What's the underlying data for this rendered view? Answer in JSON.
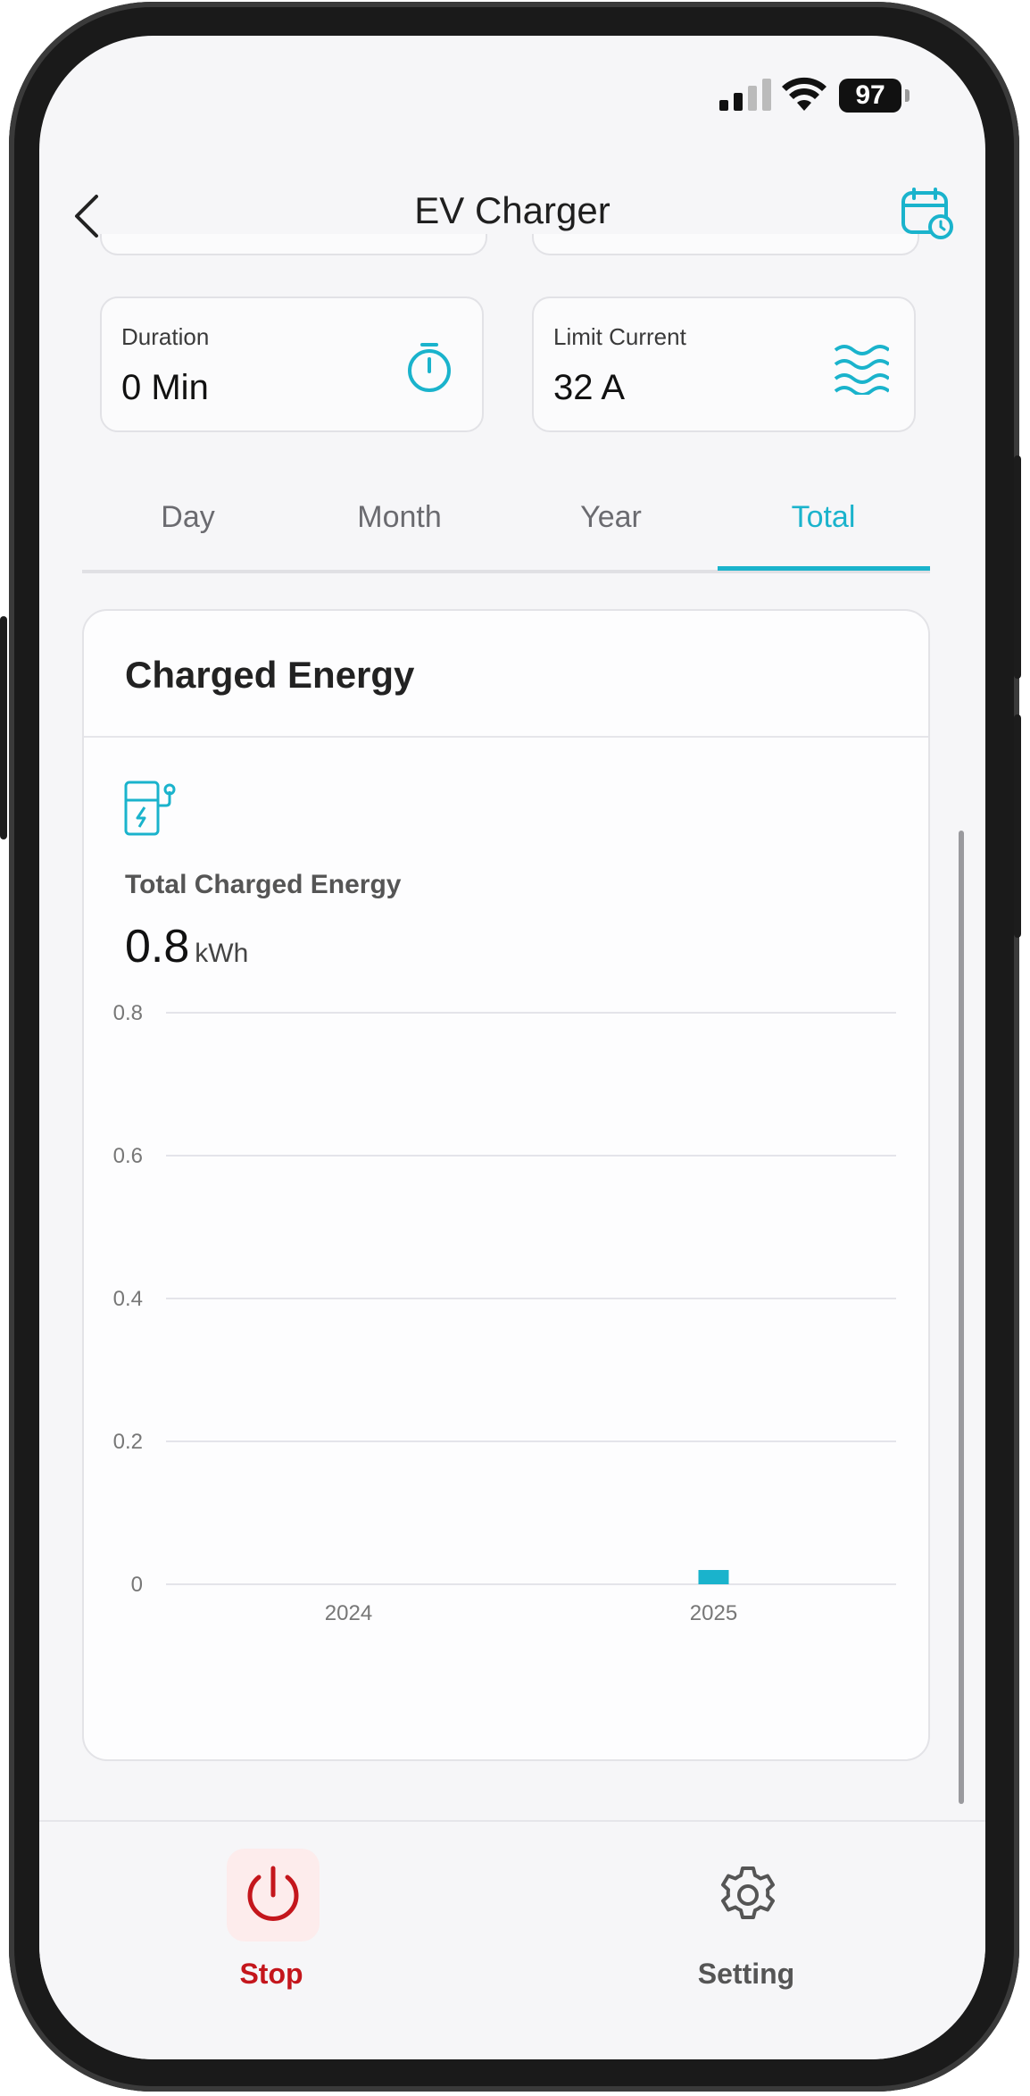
{
  "status_bar": {
    "battery": "97"
  },
  "header": {
    "title": "EV Charger"
  },
  "stats": [
    {
      "label": "Duration",
      "value": "0 Min",
      "icon": "stopwatch-icon"
    },
    {
      "label": "Limit Current",
      "value": "32 A",
      "icon": "current-waves-icon"
    }
  ],
  "tabs": [
    {
      "label": "Day"
    },
    {
      "label": "Month"
    },
    {
      "label": "Year"
    },
    {
      "label": "Total"
    }
  ],
  "active_tab": "Total",
  "panel": {
    "title": "Charged Energy",
    "total_label": "Total Charged Energy",
    "total_value": "0.8",
    "total_unit": "kWh"
  },
  "chart_data": {
    "type": "bar",
    "categories": [
      "2024",
      "2025"
    ],
    "values": [
      0,
      0.02
    ],
    "title": "",
    "xlabel": "",
    "ylabel": "",
    "ylim": [
      0,
      0.8
    ],
    "yticks": [
      "0",
      "0.2",
      "0.4",
      "0.6",
      "0.8"
    ],
    "grid": true,
    "color": "#1ab3cc"
  },
  "bottom_nav": [
    {
      "label": "Stop",
      "icon": "power-icon",
      "color": "#c4161c"
    },
    {
      "label": "Setting",
      "icon": "gear-icon",
      "color": "#555555"
    }
  ],
  "colors": {
    "accent": "#1ab3cc",
    "stop": "#c4161c"
  }
}
